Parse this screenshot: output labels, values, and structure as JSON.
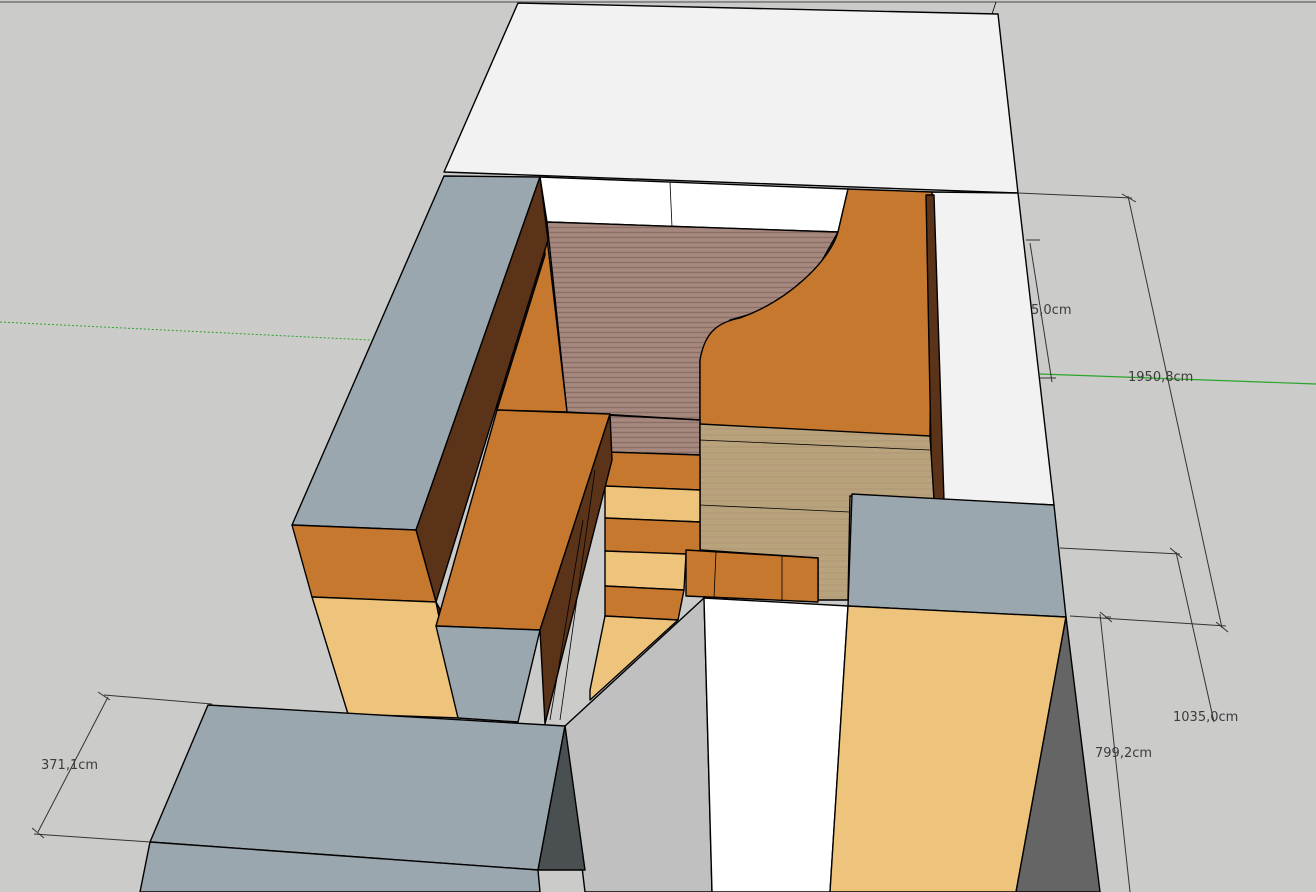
{
  "app": {
    "name": "3D modeling viewport",
    "view": "perspective"
  },
  "dimensions": [
    {
      "id": "dim-depth-small",
      "label": "5,0cm"
    },
    {
      "id": "dim-width-total",
      "label": "1950,8cm"
    },
    {
      "id": "dim-height-total",
      "label": "1035,0cm"
    },
    {
      "id": "dim-height-mid",
      "label": "799,2cm"
    },
    {
      "id": "dim-height-left",
      "label": "371,1cm"
    }
  ],
  "colors": {
    "background": "#cbcbca",
    "concrete_gray": "#9ba7ae",
    "wall_white": "#f2f2f2",
    "wood_orange": "#c7782f",
    "wood_dark": "#5a3318",
    "light_wood": "#eec37c",
    "tan": "#b9a17a",
    "green_axis": "#2aa52a"
  }
}
